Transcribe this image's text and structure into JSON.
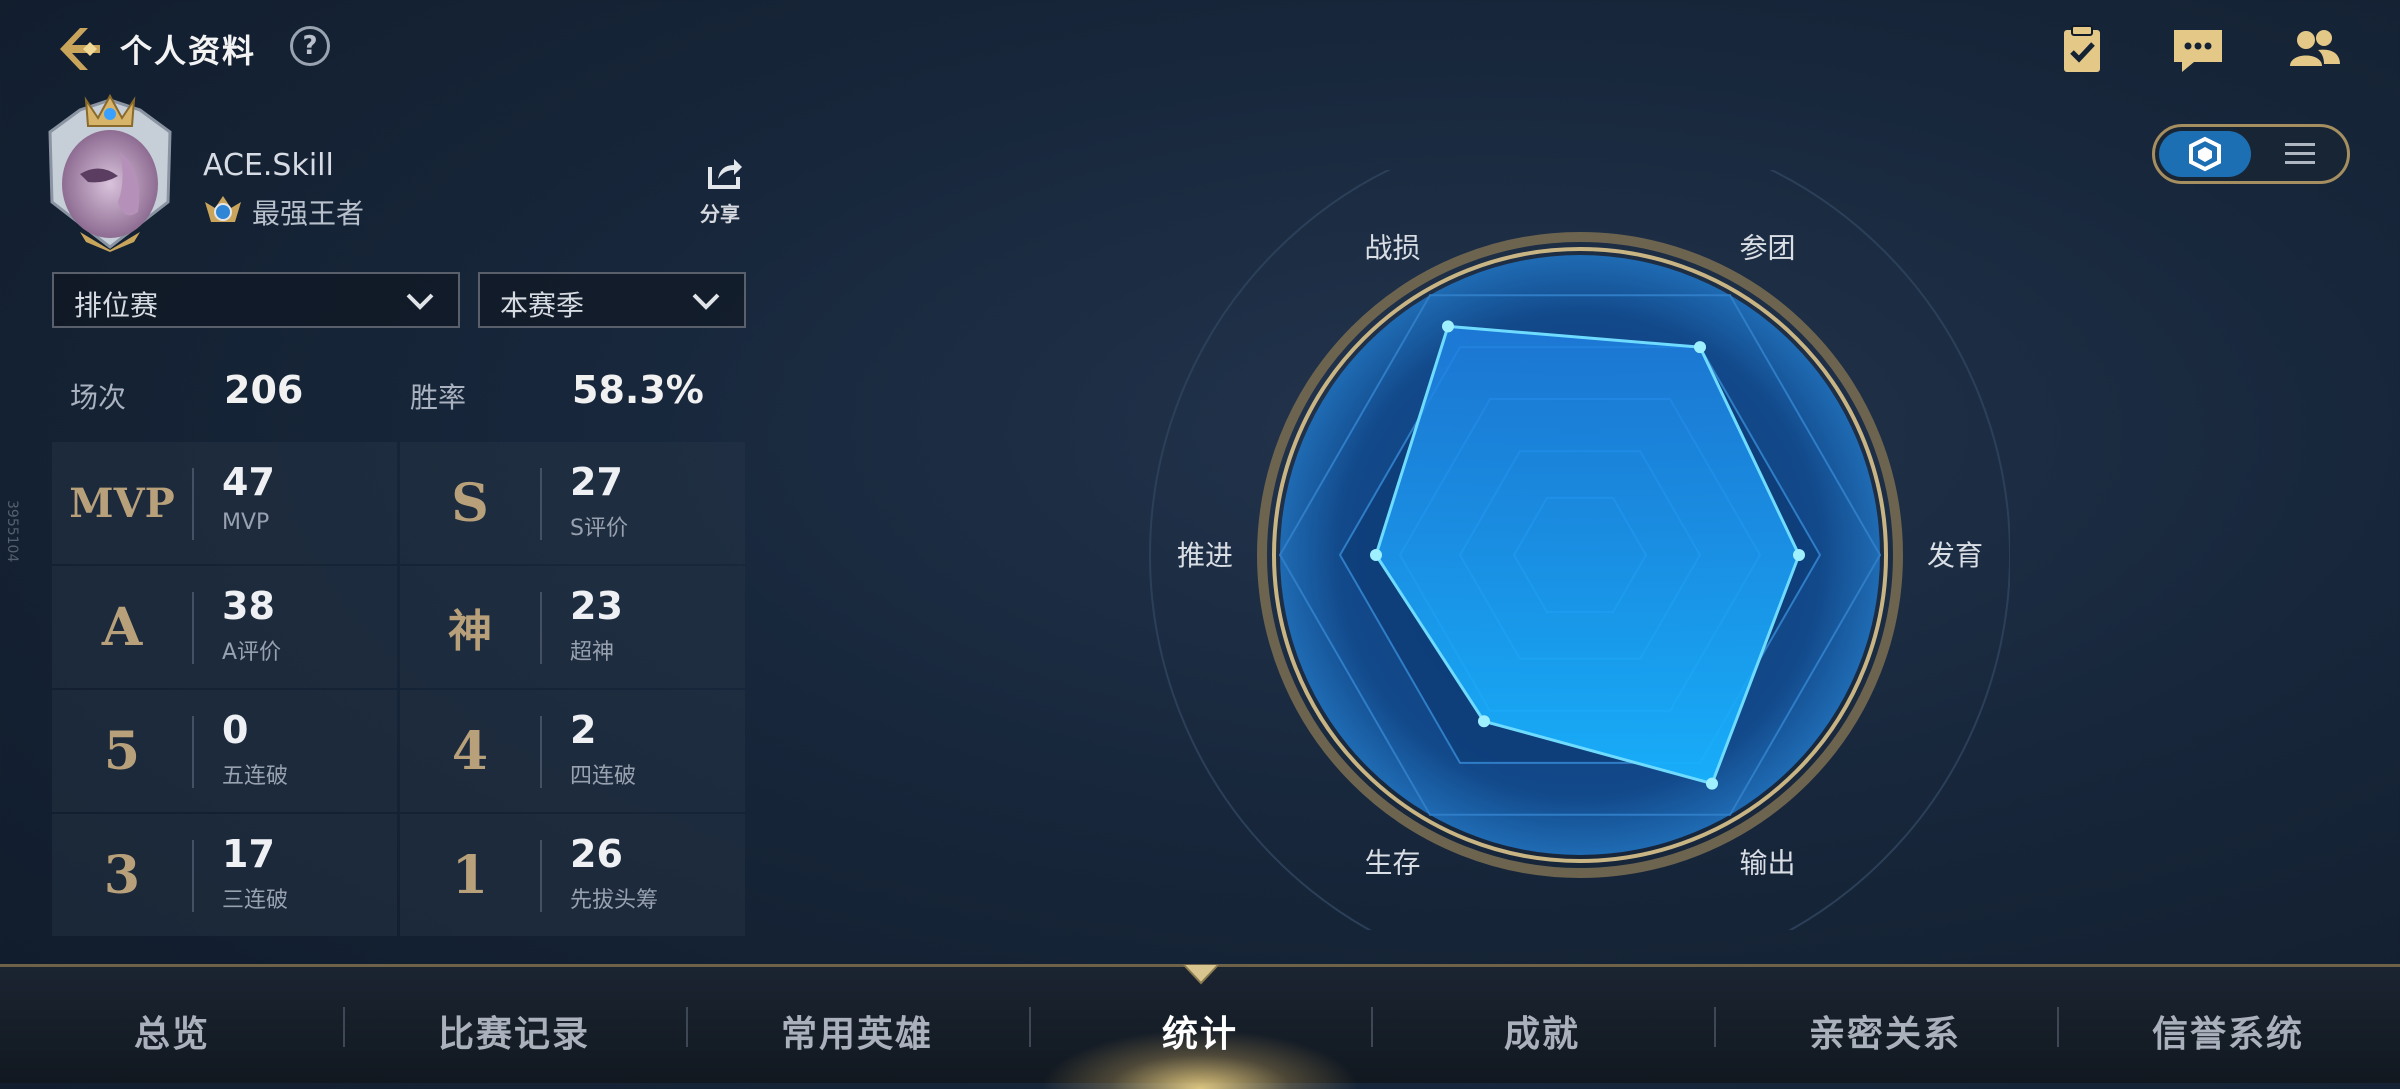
{
  "header": {
    "title": "个人资料",
    "help_label": "?"
  },
  "profile": {
    "name": "ACE.Skill",
    "rank": "最强王者",
    "share_label": "分享"
  },
  "filters": {
    "mode": "排位赛",
    "season": "本赛季"
  },
  "summary": {
    "games_label": "场次",
    "games_value": "206",
    "winrate_label": "胜率",
    "winrate_value": "58.3%"
  },
  "stats": [
    {
      "glyph": "MVP",
      "value": "47",
      "label": "MVP"
    },
    {
      "glyph": "S",
      "value": "27",
      "label": "S评价"
    },
    {
      "glyph": "A",
      "value": "38",
      "label": "A评价"
    },
    {
      "glyph": "神",
      "value": "23",
      "label": "超神"
    },
    {
      "glyph": "5",
      "value": "0",
      "label": "五连破"
    },
    {
      "glyph": "4",
      "value": "2",
      "label": "四连破"
    },
    {
      "glyph": "3",
      "value": "17",
      "label": "三连破"
    },
    {
      "glyph": "1",
      "value": "26",
      "label": "先拔头筹"
    }
  ],
  "radar": {
    "axes": [
      "战损",
      "参团",
      "发育",
      "输出",
      "生存",
      "推进"
    ],
    "values": [
      0.88,
      0.8,
      0.73,
      0.88,
      0.64,
      0.68
    ],
    "color": "#1ea0ff"
  },
  "side_code": "3955104",
  "tabs": [
    "总览",
    "比赛记录",
    "常用英雄",
    "统计",
    "成就",
    "亲密关系",
    "信誉系统"
  ],
  "active_tab": "统计",
  "colors": {
    "gold": "#b8a17a",
    "accent": "#1d6fb3"
  }
}
